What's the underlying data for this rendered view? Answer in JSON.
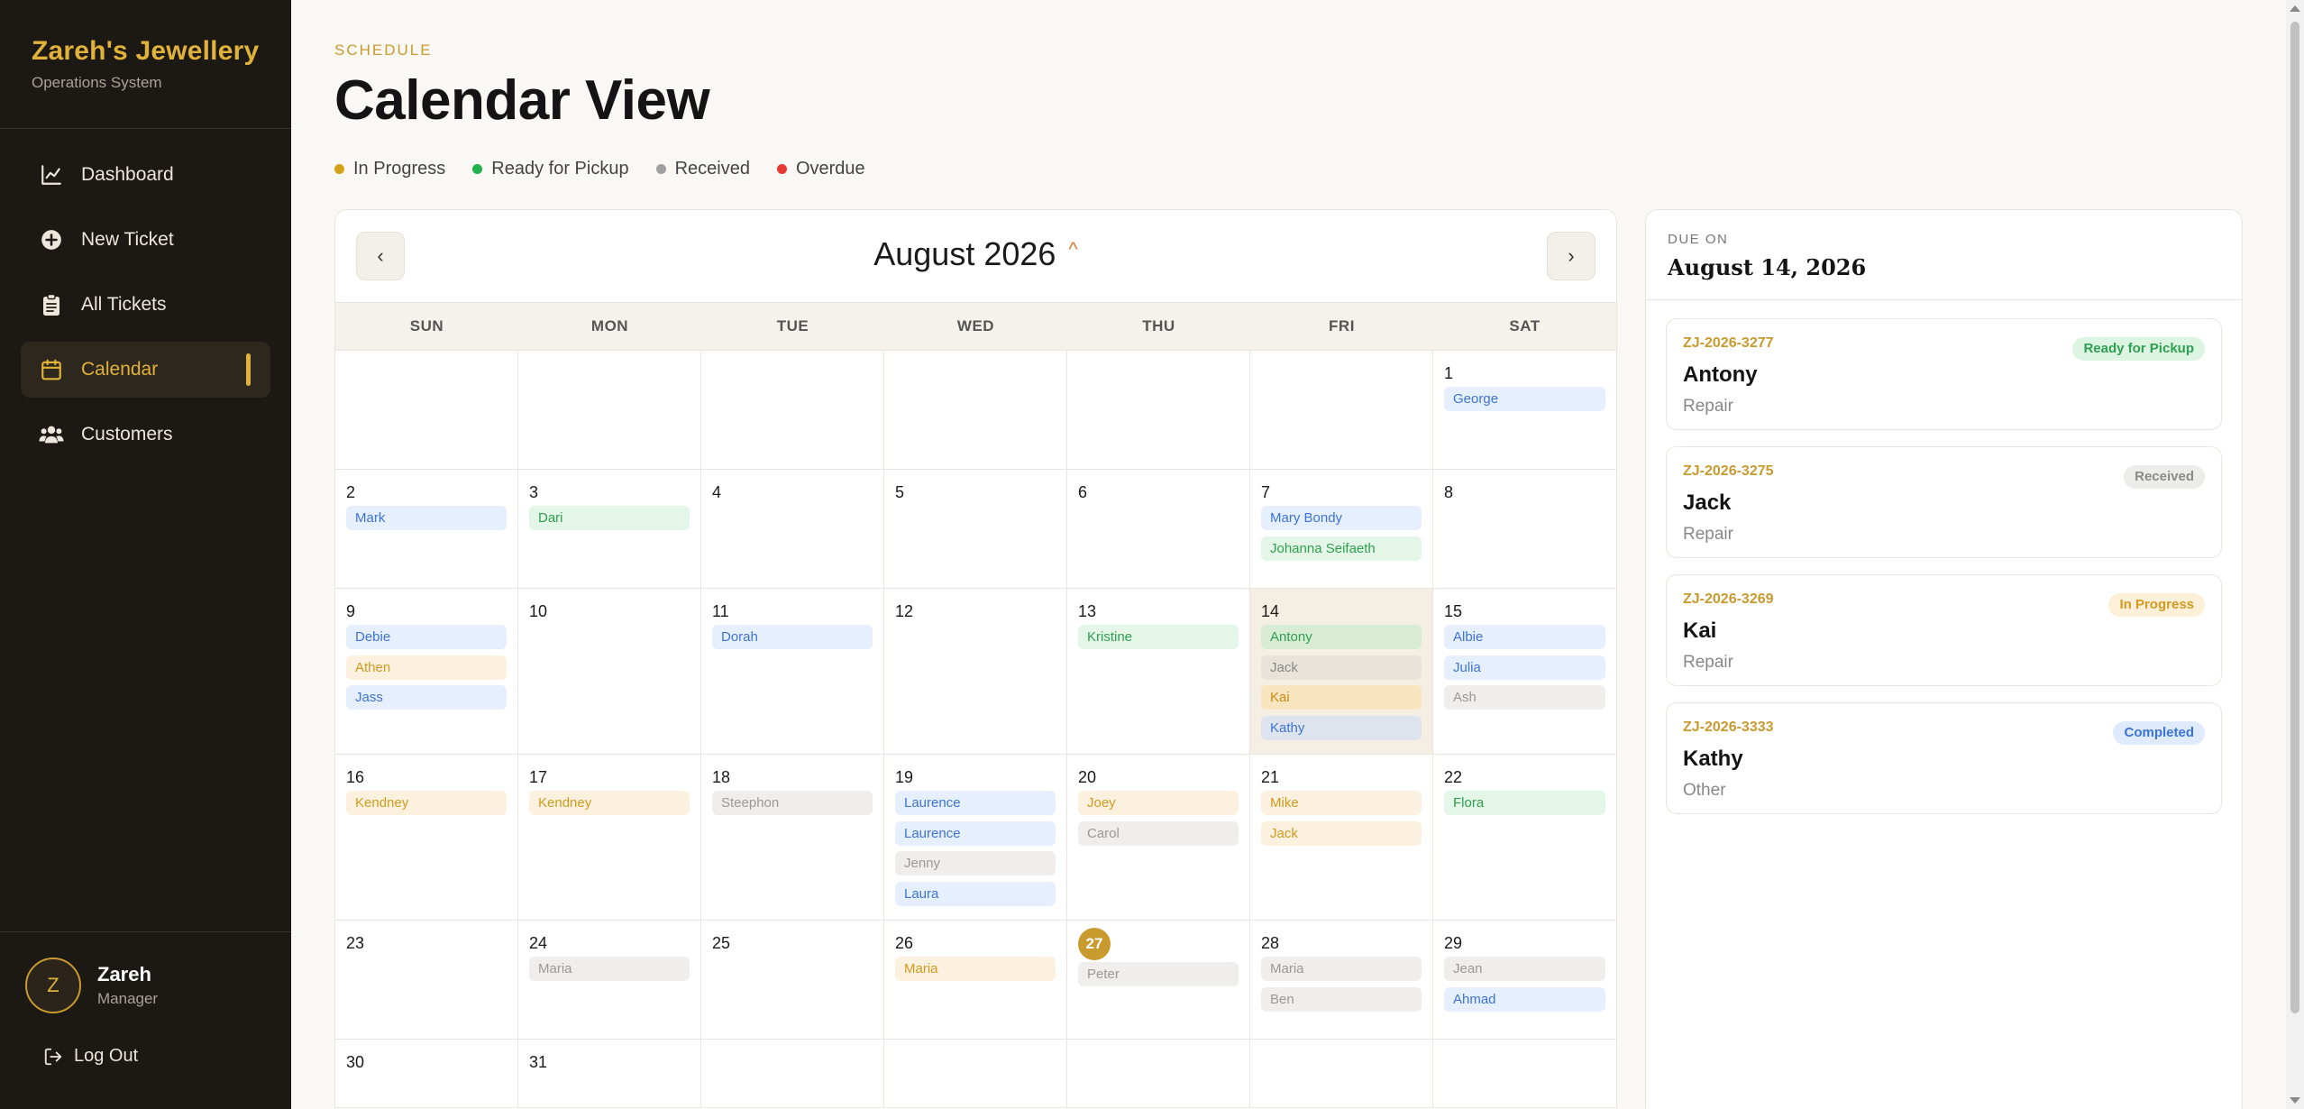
{
  "sidebar": {
    "brand_title": "Zareh's Jewellery",
    "brand_subtitle": "Operations System",
    "items": [
      {
        "label": "Dashboard",
        "icon": "chart-line-icon"
      },
      {
        "label": "New Ticket",
        "icon": "plus-circle-icon"
      },
      {
        "label": "All Tickets",
        "icon": "clipboard-icon"
      },
      {
        "label": "Calendar",
        "icon": "calendar-icon",
        "active": true
      },
      {
        "label": "Customers",
        "icon": "users-icon"
      }
    ],
    "user": {
      "initial": "Z",
      "name": "Zareh",
      "role": "Manager"
    },
    "logout_label": "Log Out"
  },
  "header": {
    "eyebrow": "SCHEDULE",
    "title": "Calendar View"
  },
  "legend": [
    {
      "label": "In Progress",
      "color": "#d4a017"
    },
    {
      "label": "Ready for Pickup",
      "color": "#22b14c"
    },
    {
      "label": "Received",
      "color": "#a0a0a0"
    },
    {
      "label": "Overdue",
      "color": "#e53935"
    }
  ],
  "calendar": {
    "month_label": "August 2026",
    "caret": "^",
    "prev_label": "‹",
    "next_label": "›",
    "weekdays": [
      "SUN",
      "MON",
      "TUE",
      "WED",
      "THU",
      "FRI",
      "SAT"
    ],
    "selected_day": 14,
    "today": 27,
    "days": {
      "1": [
        {
          "name": "George",
          "color": "blue"
        }
      ],
      "2": [
        {
          "name": "Mark",
          "color": "blue"
        }
      ],
      "3": [
        {
          "name": "Dari",
          "color": "green"
        }
      ],
      "7": [
        {
          "name": "Mary Bondy",
          "color": "blue"
        },
        {
          "name": "Johanna Seifaeth",
          "color": "green"
        }
      ],
      "9": [
        {
          "name": "Debie",
          "color": "blue"
        },
        {
          "name": "Athen",
          "color": "yellow"
        },
        {
          "name": "Jass",
          "color": "blue"
        }
      ],
      "11": [
        {
          "name": "Dorah",
          "color": "blue"
        }
      ],
      "13": [
        {
          "name": "Kristine",
          "color": "green"
        }
      ],
      "14": [
        {
          "name": "Antony",
          "color": "sel-green"
        },
        {
          "name": "Jack",
          "color": "sel-gray"
        },
        {
          "name": "Kai",
          "color": "sel-yellow"
        },
        {
          "name": "Kathy",
          "color": "sel-blue"
        }
      ],
      "15": [
        {
          "name": "Albie",
          "color": "blue"
        },
        {
          "name": "Julia",
          "color": "blue"
        },
        {
          "name": "Ash",
          "color": "gray"
        }
      ],
      "16": [
        {
          "name": "Kendney",
          "color": "yellow"
        }
      ],
      "17": [
        {
          "name": "Kendney",
          "color": "yellow"
        }
      ],
      "18": [
        {
          "name": "Steephon",
          "color": "gray"
        }
      ],
      "19": [
        {
          "name": "Laurence",
          "color": "blue"
        },
        {
          "name": "Laurence",
          "color": "blue"
        },
        {
          "name": "Jenny",
          "color": "gray"
        },
        {
          "name": "Laura",
          "color": "blue"
        }
      ],
      "20": [
        {
          "name": "Joey",
          "color": "yellow"
        },
        {
          "name": "Carol",
          "color": "gray"
        }
      ],
      "21": [
        {
          "name": "Mike",
          "color": "yellow"
        },
        {
          "name": "Jack",
          "color": "yellow"
        }
      ],
      "22": [
        {
          "name": "Flora",
          "color": "green"
        }
      ],
      "24": [
        {
          "name": "Maria",
          "color": "gray"
        }
      ],
      "26": [
        {
          "name": "Maria",
          "color": "yellow"
        }
      ],
      "27": [
        {
          "name": "Peter",
          "color": "gray"
        }
      ],
      "28": [
        {
          "name": "Maria",
          "color": "gray"
        },
        {
          "name": "Ben",
          "color": "gray"
        }
      ],
      "29": [
        {
          "name": "Jean",
          "color": "gray"
        },
        {
          "name": "Ahmad",
          "color": "blue"
        }
      ]
    }
  },
  "side_panel": {
    "due_label": "DUE ON",
    "due_date": "August 14, 2026",
    "tickets": [
      {
        "id": "ZJ-2026-3277",
        "name": "Antony",
        "type": "Repair",
        "status": "Ready for Pickup",
        "status_color": "green"
      },
      {
        "id": "ZJ-2026-3275",
        "name": "Jack",
        "type": "Repair",
        "status": "Received",
        "status_color": "gray"
      },
      {
        "id": "ZJ-2026-3269",
        "name": "Kai",
        "type": "Repair",
        "status": "In Progress",
        "status_color": "yellow"
      },
      {
        "id": "ZJ-2026-3333",
        "name": "Kathy",
        "type": "Other",
        "status": "Completed",
        "status_color": "blue"
      }
    ]
  }
}
